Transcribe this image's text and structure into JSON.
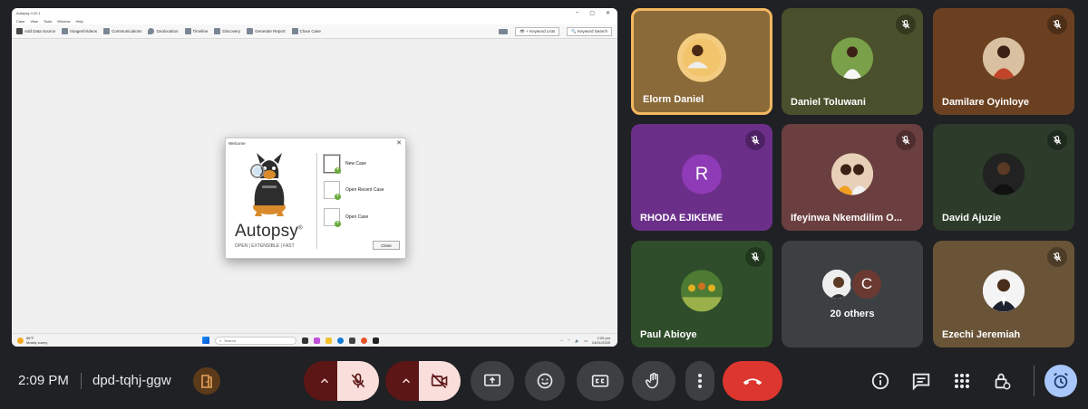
{
  "screen": {
    "window_title": "Autopsy 4.22.1",
    "menu": [
      "Case",
      "View",
      "Tools",
      "Window",
      "Help"
    ],
    "toolbar": [
      "Add Data Source",
      "Images/Videos",
      "Communications",
      "Geolocation",
      "Timeline",
      "Discovery",
      "Generate Report",
      "Close Case"
    ],
    "toolbar_right": [
      "Keyword Lists",
      "Keyword Search"
    ],
    "dialog": {
      "title": "Welcome",
      "brand": "Autopsy",
      "registered": "®",
      "tagline": "OPEN | EXTENSIBLE | FAST",
      "options": [
        "New Case",
        "Open Recent Case",
        "Open Case"
      ],
      "close_button": "Close"
    },
    "taskbar": {
      "weather_temp": "86°F",
      "weather_desc": "Mostly sunny",
      "search_placeholder": "Search",
      "time": "2:09 pm",
      "date": "24/01/2025"
    }
  },
  "participants": [
    {
      "name": "Elorm Daniel",
      "muted": false,
      "speaking": true,
      "bg": "#8a6a38"
    },
    {
      "name": "Daniel Toluwani",
      "muted": true,
      "bg": "#4a4f2c"
    },
    {
      "name": "Damilare Oyinloye",
      "muted": true,
      "bg": "#6b4021"
    },
    {
      "name": "RHODA EJIKEME",
      "muted": true,
      "bg": "#6b2f8a",
      "initial": "R",
      "avatar_color": "#8f3bb8"
    },
    {
      "name": "Ifeyinwa Nkemdilim O...",
      "muted": true,
      "bg": "#6b3f3f"
    },
    {
      "name": "David Ajuzie",
      "muted": true,
      "bg": "#2c3b2a"
    },
    {
      "name": "Paul Abioye",
      "muted": true,
      "bg": "#2f4d2a"
    },
    {
      "name": "20 others",
      "initial": "C",
      "bg": "#3c4043",
      "avatar_color": "#6a3a32"
    },
    {
      "name": "Ezechi Jeremiah",
      "muted": true,
      "bg": "#6a5438"
    }
  ],
  "bottom_bar": {
    "time": "2:09 PM",
    "meeting_code": "dpd-tqhj-ggw"
  },
  "colors": {
    "mic_off_bg": "#f9dedc",
    "split_left_bg": "#5c1616",
    "hangup": "#dc362e",
    "speaking_border": "#f3b760"
  }
}
